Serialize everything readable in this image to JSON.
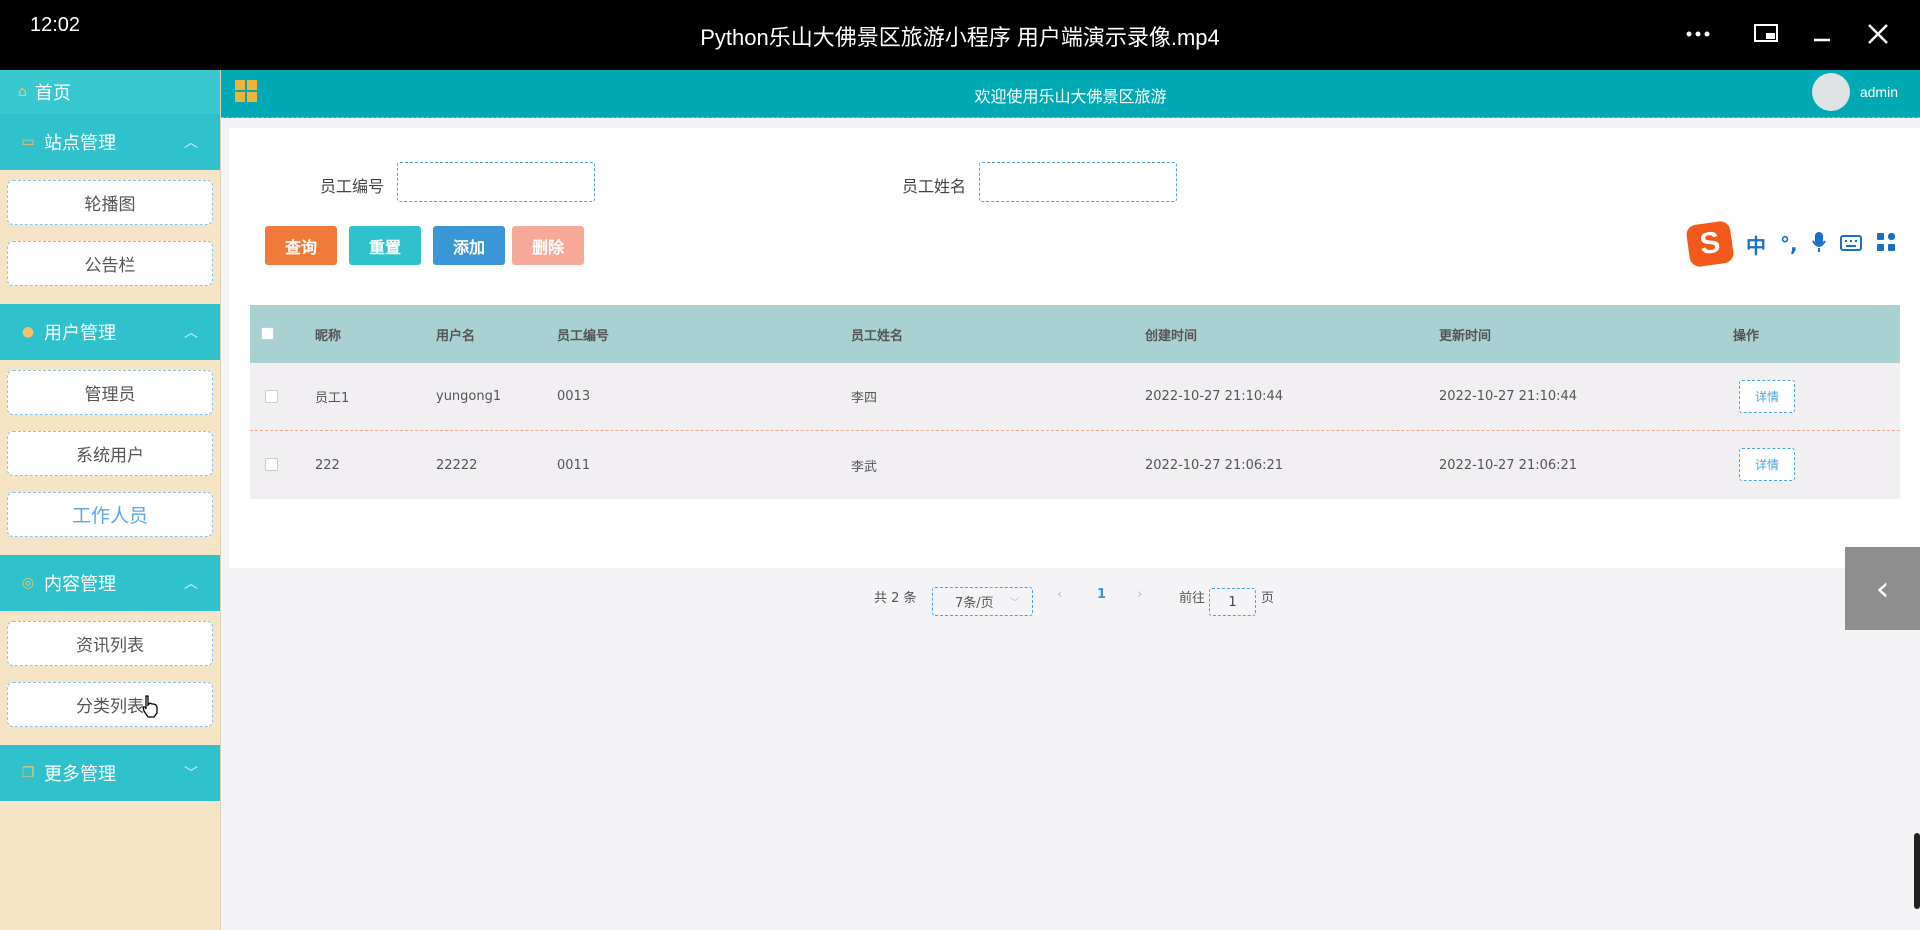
{
  "player": {
    "clock": "12:02",
    "title": "Python乐山大佛景区旅游小程序  用户端演示录像.mp4"
  },
  "sidebar": {
    "home": "首页",
    "groups": [
      {
        "label": "站点管理",
        "items": [
          "轮播图",
          "公告栏"
        ]
      },
      {
        "label": "用户管理",
        "items": [
          "管理员",
          "系统用户",
          "工作人员"
        ]
      },
      {
        "label": "内容管理",
        "items": [
          "资讯列表",
          "分类列表"
        ]
      },
      {
        "label": "更多管理",
        "items": []
      }
    ],
    "active_item": "工作人员"
  },
  "topbar": {
    "welcome": "欢迎使用乐山大佛景区旅游",
    "user": "admin"
  },
  "search": {
    "emp_no_label": "员工编号",
    "emp_no_value": "",
    "emp_name_label": "员工姓名",
    "emp_name_value": ""
  },
  "buttons": {
    "query": "查询",
    "reset": "重置",
    "add": "添加",
    "delete": "删除"
  },
  "table": {
    "headers": [
      "昵称",
      "用户名",
      "员工编号",
      "员工姓名",
      "创建时间",
      "更新时间",
      "操作"
    ],
    "rows": [
      {
        "nickname": "员工1",
        "username": "yungong1",
        "emp_no": "0013",
        "emp_name": "李四",
        "created": "2022-10-27 21:10:44",
        "updated": "2022-10-27 21:10:44",
        "action": "详情"
      },
      {
        "nickname": "222",
        "username": "22222",
        "emp_no": "0011",
        "emp_name": "李武",
        "created": "2022-10-27 21:06:21",
        "updated": "2022-10-27 21:06:21",
        "action": "详情"
      }
    ]
  },
  "pagination": {
    "total": "共 2 条",
    "page_size": "7条/页",
    "current_page": "1",
    "goto_label": "前往",
    "goto_value": "1",
    "page_unit": "页"
  },
  "ime": {
    "logo": "S",
    "items": [
      "中",
      "°,"
    ]
  },
  "colors": {
    "teal_header": "#00aab5",
    "sidebar_group": "#2fc2cc",
    "query_btn": "#f07a3a",
    "reset_btn": "#2fc2cc",
    "add_btn": "#3a96d6",
    "delete_btn": "#f6a999"
  }
}
